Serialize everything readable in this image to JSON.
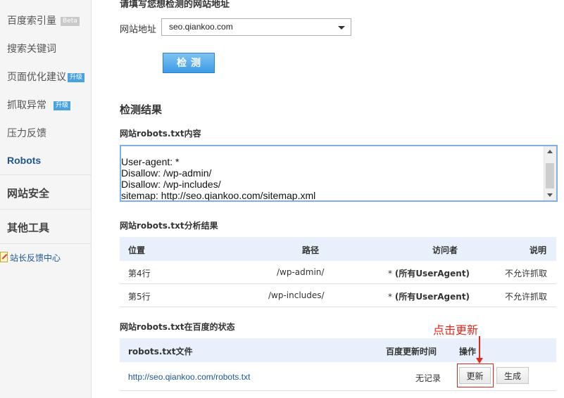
{
  "sidebar": {
    "items": [
      {
        "label": "百度索引量",
        "badge": "Beta"
      },
      {
        "label": "搜索关键词",
        "badge": ""
      },
      {
        "label": "页面优化建议",
        "badge": "升级"
      },
      {
        "label": "抓取异常",
        "badge": "升级"
      },
      {
        "label": "压力反馈",
        "badge": ""
      },
      {
        "label": "Robots",
        "badge": ""
      }
    ],
    "groups": [
      "网站安全",
      "其他工具"
    ],
    "feedback_link": "站长反馈中心"
  },
  "form": {
    "heading": "请填写您想检测的网站地址",
    "url_label": "网站地址",
    "url_value": "seo.qiankoo.com",
    "check_button": "检测"
  },
  "results": {
    "title": "检测结果",
    "robots_content_title": "网站robots.txt内容",
    "robots_lines": [
      "User-agent: *",
      "Disallow: /wp-admin/",
      "Disallow: /wp-includes/",
      "sitemap: http://seo.qiankoo.com/sitemap.xml"
    ],
    "analysis_title": "网站robots.txt分析结果",
    "analysis_headers": [
      "位置",
      "路径",
      "访问者",
      "说明"
    ],
    "analysis_rows": [
      {
        "position": "第4行",
        "path": "/wp-admin/",
        "visitor_star": "*",
        "visitor": "(所有UserAgent)",
        "note": "不允许抓取"
      },
      {
        "position": "第5行",
        "path": "/wp-includes/",
        "visitor_star": "*",
        "visitor": "(所有UserAgent)",
        "note": "不允许抓取"
      }
    ],
    "status_title": "网站robots.txt在百度的状态",
    "status_headers": [
      "robots.txt文件",
      "百度更新时间",
      "操作"
    ],
    "status_row": {
      "file": "http://seo.qiankoo.com/robots.txt",
      "update_time": "无记录",
      "update_button": "更新",
      "generate_button": "生成"
    }
  },
  "annotation": {
    "text": "点击更新",
    "color": "#e1261c"
  },
  "colors": {
    "accent": "#4aa3df",
    "link": "#1e5494",
    "table_header_bg": "#e8f1fb"
  }
}
